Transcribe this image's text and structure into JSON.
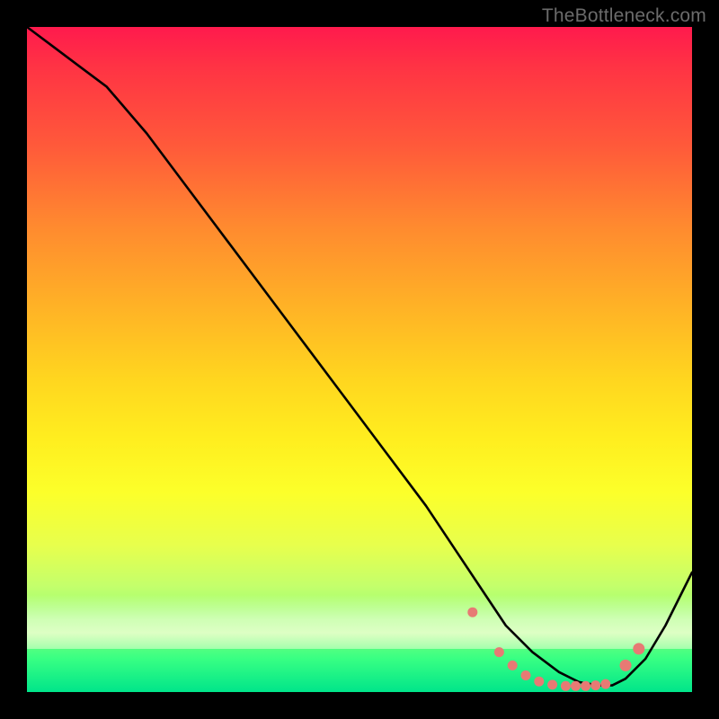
{
  "watermark": "TheBottleneck.com",
  "colors": {
    "page_bg": "#000000",
    "curve_stroke": "#000000",
    "marker_fill": "#e77a74",
    "gradient_top": "#ff1a4d",
    "gradient_bottom": "#00e58a"
  },
  "chart_data": {
    "type": "line",
    "title": "",
    "xlabel": "",
    "ylabel": "",
    "xlim": [
      0,
      100
    ],
    "ylim": [
      0,
      100
    ],
    "series": [
      {
        "name": "curve",
        "x": [
          0,
          4,
          8,
          12,
          18,
          24,
          30,
          36,
          42,
          48,
          54,
          60,
          64,
          68,
          72,
          76,
          80,
          83,
          86,
          88,
          90,
          93,
          96,
          100
        ],
        "y": [
          100,
          97,
          94,
          91,
          84,
          76,
          68,
          60,
          52,
          44,
          36,
          28,
          22,
          16,
          10,
          6,
          3,
          1.5,
          1,
          1,
          2,
          5,
          10,
          18
        ]
      }
    ],
    "markers": {
      "name": "bottom-dots",
      "x": [
        67,
        71,
        73,
        75,
        77,
        79,
        81,
        82.5,
        84,
        85.5,
        87,
        90,
        92
      ],
      "y": [
        12,
        6,
        4,
        2.5,
        1.6,
        1.1,
        0.9,
        0.9,
        0.9,
        1.0,
        1.2,
        4,
        6.5
      ],
      "r": [
        5.5,
        5.5,
        5.5,
        5.5,
        5.5,
        5.5,
        5.5,
        5.5,
        5.5,
        5.5,
        5.5,
        6.5,
        6.5
      ]
    }
  }
}
